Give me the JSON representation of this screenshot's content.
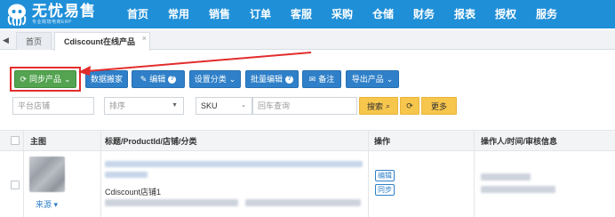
{
  "brand": {
    "name": "无忧易售",
    "tagline": "专业跨境电商ERP"
  },
  "nav": [
    "首页",
    "常用",
    "销售",
    "订单",
    "客服",
    "采购",
    "仓储",
    "财务",
    "报表",
    "授权",
    "服务"
  ],
  "tabs": {
    "home": "首页",
    "active": "Cdiscount在线产品",
    "close": "×"
  },
  "toolbar": {
    "sync": "同步产品",
    "move": "数据搬家",
    "edit": "编辑",
    "category": "设置分类",
    "batch_edit": "批量编辑",
    "note": "备注",
    "export": "导出产品"
  },
  "filters": {
    "store_placeholder": "平台店铺",
    "sort_placeholder": "排序",
    "sku_option": "SKU",
    "query_placeholder": "回车查询",
    "search": "搜索",
    "more": "更多"
  },
  "table": {
    "headers": {
      "image": "主图",
      "title": "标题/ProductId/店铺/分类",
      "action": "操作",
      "operator": "操作人/时间/审核信息"
    },
    "rows": [
      {
        "store": "Cdiscount店铺1",
        "source": "来源",
        "actions": [
          "编辑",
          "同步"
        ]
      }
    ]
  },
  "colors": {
    "nav": "#1f8fd8",
    "primary": "#2f80c8",
    "green": "#53a351",
    "highlight": "#e22d2d",
    "search": "#f6c64d"
  }
}
